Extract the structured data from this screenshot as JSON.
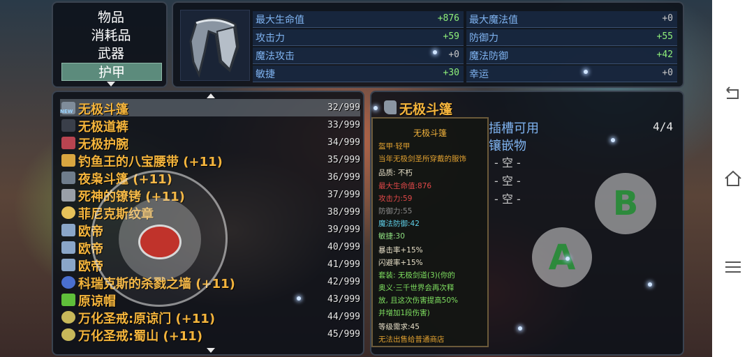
{
  "categories": {
    "items": [
      "物品",
      "消耗品",
      "武器",
      "护甲"
    ],
    "selected_index": 3
  },
  "stats": {
    "left": [
      {
        "name": "最大生命值",
        "value": "+876"
      },
      {
        "name": "攻击力",
        "value": "+59"
      },
      {
        "name": "魔法攻击",
        "value": "+0"
      },
      {
        "name": "敏捷",
        "value": "+30"
      }
    ],
    "right": [
      {
        "name": "最大魔法值",
        "value": "+0"
      },
      {
        "name": "防御力",
        "value": "+55"
      },
      {
        "name": "魔法防御",
        "value": "+42"
      },
      {
        "name": "幸运",
        "value": "+0"
      }
    ],
    "positive_color": "#8ff07a",
    "zero_color": "#c8c8c8"
  },
  "inventory": {
    "new_badge": "NEW",
    "items": [
      {
        "name": "无极斗篷",
        "count": "32/999",
        "icon_color": "#7f8c9a",
        "icon": "cloak-icon"
      },
      {
        "name": "无极道裤",
        "count": "33/999",
        "icon_color": "#3a3f4a",
        "icon": "pants-icon"
      },
      {
        "name": "无极护腕",
        "count": "34/999",
        "icon_color": "#b84450",
        "icon": "bracer-icon"
      },
      {
        "name": "钓鱼王的八宝腰带 (+11)",
        "count": "35/999",
        "icon_color": "#d9a640",
        "icon": "belt-icon"
      },
      {
        "name": "夜枭斗篷 (+11)",
        "count": "36/999",
        "icon_color": "#6f7d8c",
        "icon": "cloak-icon"
      },
      {
        "name": "死神的镣铐 (+11)",
        "count": "37/999",
        "icon_color": "#9aa0a8",
        "icon": "shackle-icon"
      },
      {
        "name": "菲尼克斯纹章",
        "count": "38/999",
        "icon_color": "#e6c25a",
        "icon": "emblem-icon"
      },
      {
        "name": "欧帝",
        "count": "39/999",
        "icon_color": "#8aa6c8",
        "icon": "scroll-icon"
      },
      {
        "name": "欧帝",
        "count": "40/999",
        "icon_color": "#8aa6c8",
        "icon": "scroll-icon"
      },
      {
        "name": "欧帝",
        "count": "41/999",
        "icon_color": "#8aa6c8",
        "icon": "scroll-icon"
      },
      {
        "name": "科瑞克斯的杀戮之墙 (+11)",
        "count": "42/999",
        "icon_color": "#4a6fd0",
        "icon": "ring-icon"
      },
      {
        "name": "原谅帽",
        "count": "43/999",
        "icon_color": "#5fbf3a",
        "icon": "hat-icon"
      },
      {
        "name": "万化圣戒:原谅门 (+11)",
        "count": "44/999",
        "icon_color": "#c8b85a",
        "icon": "ring-icon"
      },
      {
        "name": "万化圣戒:蜀山 (+11)",
        "count": "45/999",
        "icon_color": "#c8b85a",
        "icon": "ring-icon"
      }
    ]
  },
  "detail": {
    "name": "无极斗篷",
    "tooltip": {
      "title": "无极斗篷",
      "type": "盔甲·轻甲",
      "desc": "当年无极剑圣所穿戴的服饰",
      "quality": "品质: 不朽",
      "max_hp": "最大生命值:876",
      "attack": "攻击力:59",
      "defense": "防御力:55",
      "magic_def": "魔法防御:42",
      "agility": "敏捷:30",
      "crit": "暴击率+15%",
      "dodge": "闪避率+15%",
      "set_line1": "套装: 无极剑道(3)(你的",
      "set_line2": "奥义·三千世界会再次释",
      "set_line3": "放, 且这次伤害提高50%",
      "set_line4": "并增加1段伤害)",
      "level": "等级需求:45",
      "unsellable": "无法出售给普通商店"
    },
    "slot_title": "插槽可用",
    "slot_count": "4/4",
    "inlay_title": "镶嵌物",
    "empty_slots": [
      "- 空 -",
      "- 空 -",
      "- 空 -"
    ]
  },
  "controls": {
    "button_b": "B",
    "button_a": "A"
  },
  "android_nav": {
    "back": "back-icon",
    "home": "home-icon",
    "menu": "menu-icon"
  }
}
